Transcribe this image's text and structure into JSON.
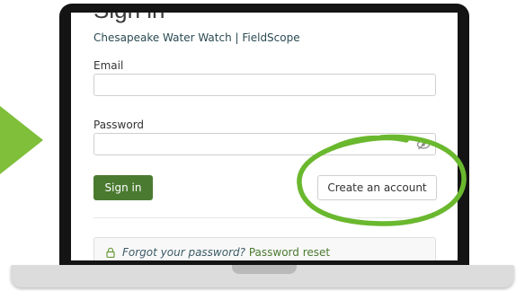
{
  "signin": {
    "title": "Sign in",
    "subtitle": "Chesapeake Water Watch | FieldScope",
    "email_label": "Email",
    "email_value": "",
    "password_label": "Password",
    "password_value": "",
    "signin_button": "Sign in",
    "create_account_button": "Create an account",
    "forgot_text": "Forgot your password?",
    "reset_link": "Password reset"
  },
  "colors": {
    "accent_green": "#4a7a30",
    "highlight_green": "#6ab82e",
    "arrow_green": "#7fbf3a"
  },
  "icons": [
    "arrow-right-icon",
    "eye-slash-icon",
    "lock-icon",
    "highlight-circle-icon"
  ]
}
